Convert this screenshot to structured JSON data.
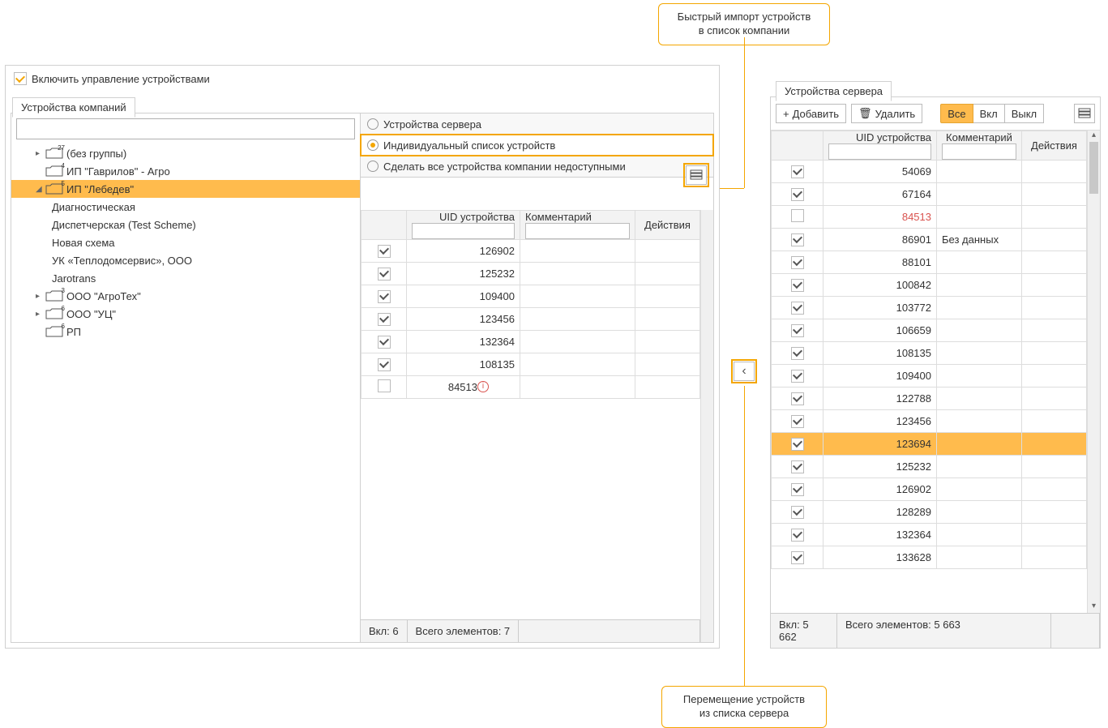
{
  "callouts": {
    "import_l1": "Быстрый импорт устройств",
    "import_l2": "в список компании",
    "move_l1": "Перемещение устройств",
    "move_l2": "из списка сервера"
  },
  "enable_label": "Включить управление устройствами",
  "companies_tab": "Устройства компаний",
  "tree": [
    {
      "label": "(без группы)",
      "badge": "27",
      "depth": 1,
      "exp": "▸"
    },
    {
      "label": "ИП \"Гаврилов\" - Агро",
      "badge": "4",
      "depth": 1,
      "exp": ""
    },
    {
      "label": "ИП \"Лебедев\"",
      "badge": "5",
      "depth": 1,
      "exp": "◢",
      "selected": true
    },
    {
      "label": "Диагностическая",
      "depth": 2
    },
    {
      "label": "Диспетчерская (Test Scheme)",
      "depth": 2
    },
    {
      "label": "Новая схема",
      "depth": 2
    },
    {
      "label": "УК «Теплодомсервис», ООО",
      "depth": 2
    },
    {
      "label": "Jarotrans",
      "depth": 2
    },
    {
      "label": "ООО \"АгроТех\"",
      "badge": "3",
      "depth": 1,
      "exp": "▸"
    },
    {
      "label": "ООО \"УЦ\"",
      "badge": "6",
      "depth": 1,
      "exp": "▸"
    },
    {
      "label": "РП",
      "badge": "6",
      "depth": 1,
      "exp": ""
    }
  ],
  "radios": {
    "r1": "Устройства сервера",
    "r2": "Индивидуальный список устройств",
    "r3": "Сделать все устройства компании недоступными"
  },
  "company_table": {
    "h_uid": "UID устройства",
    "h_comment": "Комментарий",
    "h_actions": "Действия",
    "rows": [
      {
        "checked": true,
        "uid": "126902",
        "comment": ""
      },
      {
        "checked": true,
        "uid": "125232",
        "comment": ""
      },
      {
        "checked": true,
        "uid": "109400",
        "comment": ""
      },
      {
        "checked": true,
        "uid": "123456",
        "comment": ""
      },
      {
        "checked": true,
        "uid": "132364",
        "comment": ""
      },
      {
        "checked": true,
        "uid": "108135",
        "comment": ""
      },
      {
        "checked": false,
        "uid": "84513",
        "comment": "",
        "warn": true
      }
    ],
    "footer_on": "Вкл: 6",
    "footer_total": "Всего элементов: 7"
  },
  "server_tab": "Устройства сервера",
  "server_toolbar": {
    "add": "Добавить",
    "del": "Удалить",
    "all": "Все",
    "on": "Вкл",
    "off": "Выкл"
  },
  "server_table": {
    "h_uid": "UID устройства",
    "h_comment": "Комментарий",
    "h_actions": "Действия",
    "rows": [
      {
        "checked": true,
        "uid": "54069",
        "comment": ""
      },
      {
        "checked": true,
        "uid": "67164",
        "comment": ""
      },
      {
        "checked": false,
        "uid": "84513",
        "comment": "",
        "red": true
      },
      {
        "checked": true,
        "uid": "86901",
        "comment": "Без данных"
      },
      {
        "checked": true,
        "uid": "88101",
        "comment": ""
      },
      {
        "checked": true,
        "uid": "100842",
        "comment": ""
      },
      {
        "checked": true,
        "uid": "103772",
        "comment": ""
      },
      {
        "checked": true,
        "uid": "106659",
        "comment": ""
      },
      {
        "checked": true,
        "uid": "108135",
        "comment": ""
      },
      {
        "checked": true,
        "uid": "109400",
        "comment": ""
      },
      {
        "checked": true,
        "uid": "122788",
        "comment": ""
      },
      {
        "checked": true,
        "uid": "123456",
        "comment": ""
      },
      {
        "checked": true,
        "uid": "123694",
        "comment": "",
        "selected": true
      },
      {
        "checked": true,
        "uid": "125232",
        "comment": ""
      },
      {
        "checked": true,
        "uid": "126902",
        "comment": ""
      },
      {
        "checked": true,
        "uid": "128289",
        "comment": ""
      },
      {
        "checked": true,
        "uid": "132364",
        "comment": ""
      },
      {
        "checked": true,
        "uid": "133628",
        "comment": ""
      }
    ],
    "footer_on": "Вкл: 5 662",
    "footer_total": "Всего элементов: 5 663"
  }
}
